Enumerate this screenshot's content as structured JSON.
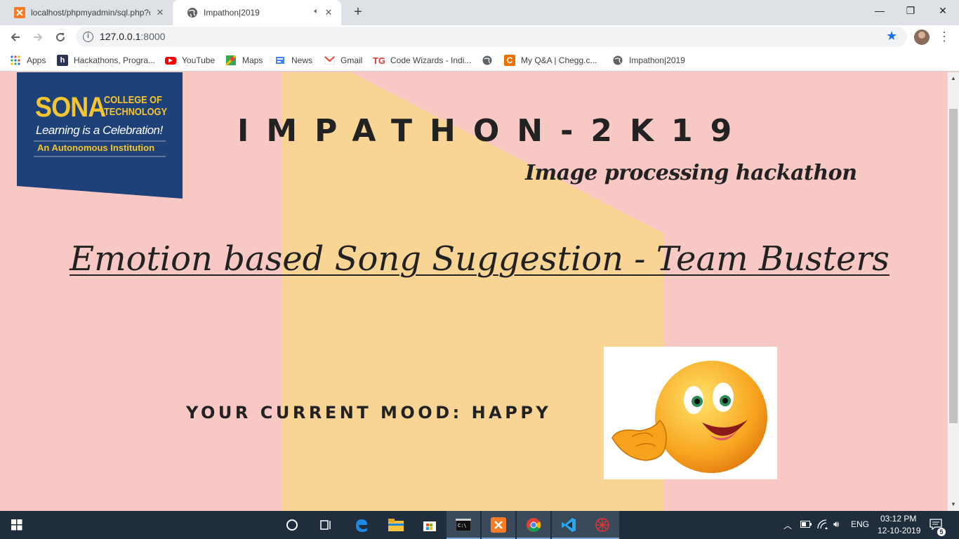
{
  "browser": {
    "tabs": [
      {
        "title": "localhost/phpmyadmin/sql.php?db=",
        "favicon": "xampp-icon",
        "active": false
      },
      {
        "title": "Impathon|2019",
        "favicon": "globe-icon",
        "active": true
      }
    ],
    "new_tab_label": "+",
    "window_controls": {
      "minimize": "—",
      "maximize": "❐",
      "close": "✕"
    },
    "url_host": "127.0.0.1",
    "url_port": ":8000",
    "bookmarks": [
      {
        "label": "Apps",
        "icon": "apps-grid-icon"
      },
      {
        "label": "Hackathons, Progra...",
        "icon": "hackerearth-icon"
      },
      {
        "label": "YouTube",
        "icon": "youtube-icon"
      },
      {
        "label": "Maps",
        "icon": "maps-icon"
      },
      {
        "label": "News",
        "icon": "news-icon"
      },
      {
        "label": "Gmail",
        "icon": "gmail-icon"
      },
      {
        "label": "Code Wizards - Indi...",
        "icon": "tg-icon"
      },
      {
        "label": "",
        "icon": "globe-icon"
      },
      {
        "label": "My Q&A | Chegg.c...",
        "icon": "chegg-icon"
      },
      {
        "label": "Impathon|2019",
        "icon": "globe-icon"
      }
    ]
  },
  "page": {
    "logo": {
      "brand": "SONA",
      "college_line1": "COLLEGE OF",
      "college_line2": "TECHNOLOGY",
      "tagline": "Learning is a Celebration!",
      "autonomous": "An Autonomous Institution"
    },
    "event_title": "IMPATHON-2K19",
    "event_subtitle": "Image processing hackathon",
    "project_title": "Emotion based Song Suggestion - Team Busters",
    "mood_label": "YOUR CURRENT MOOD: HAPPY",
    "mood_image": "happy-emoji-icon"
  },
  "taskbar": {
    "apps": [
      "cortana-icon",
      "task-view-icon",
      "edge-icon",
      "file-explorer-icon",
      "store-icon",
      "terminal-icon",
      "xampp-icon",
      "chrome-icon",
      "vscode-icon",
      "spider-app-icon"
    ],
    "language": "ENG",
    "time": "03:12 PM",
    "date": "12-10-2019",
    "notification_count": "5"
  },
  "colors": {
    "page_bg": "#f8c9c4",
    "band": "#f8d495",
    "logo_bg": "#1e4179",
    "logo_gold": "#f4c531",
    "taskbar_bg": "#1f2d3c"
  }
}
